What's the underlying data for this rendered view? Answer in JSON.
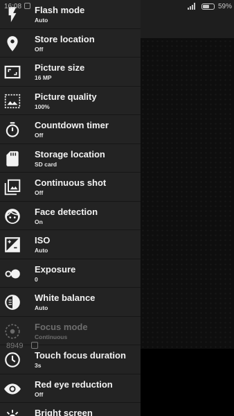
{
  "status_bar": {
    "time": "16:08",
    "battery_text": "59%",
    "battery_level": 0.59
  },
  "settings": [
    {
      "title": "Flash mode",
      "value": "Auto",
      "icon": "flash-icon"
    },
    {
      "title": "Store location",
      "value": "Off",
      "icon": "location-pin-icon"
    },
    {
      "title": "Picture size",
      "value": "16 MP",
      "icon": "picture-size-icon"
    },
    {
      "title": "Picture quality",
      "value": "100%",
      "icon": "picture-quality-icon"
    },
    {
      "title": "Countdown timer",
      "value": "Off",
      "icon": "timer-icon"
    },
    {
      "title": "Storage location",
      "value": "SD card",
      "icon": "sd-card-icon"
    },
    {
      "title": "Continuous shot",
      "value": "Off",
      "icon": "photo-library-icon"
    },
    {
      "title": "Face detection",
      "value": "On",
      "icon": "face-icon"
    },
    {
      "title": "ISO",
      "value": "Auto",
      "icon": "iso-icon"
    },
    {
      "title": "Exposure",
      "value": "0",
      "icon": "exposure-icon"
    },
    {
      "title": "White balance",
      "value": "Auto",
      "icon": "white-balance-icon"
    },
    {
      "title": "Focus mode",
      "value": "Continuous",
      "icon": "focus-icon",
      "disabled": true
    },
    {
      "title": "Touch focus duration",
      "value": "3s",
      "icon": "clock-icon"
    },
    {
      "title": "Red eye reduction",
      "value": "Off",
      "icon": "eye-icon"
    },
    {
      "title": "Bright screen",
      "value": "",
      "icon": "bright-screen-icon"
    }
  ],
  "overlay": {
    "number": "8949"
  }
}
